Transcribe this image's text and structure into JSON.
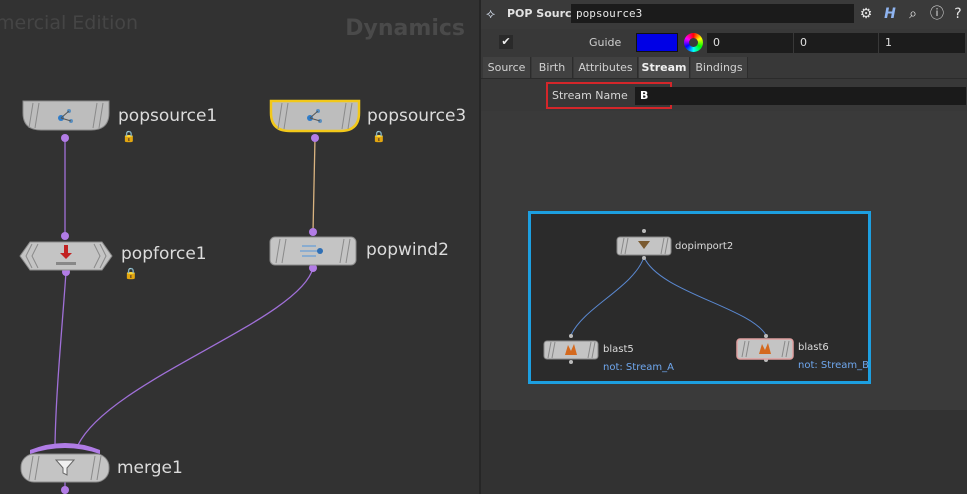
{
  "network": {
    "watermark_left": "mercial Edition",
    "watermark_right": "Dynamics",
    "nodes": {
      "popsource1": "popsource1",
      "popsource3": "popsource3",
      "popforce1": "popforce1",
      "popwind2": "popwind2",
      "merge1": "merge1"
    }
  },
  "params": {
    "node_type": "POP Source",
    "node_name": "popsource3",
    "header_icons": [
      "gear-icon",
      "help-icon",
      "search-icon",
      "info-icon",
      "help-circle-icon"
    ],
    "guide": {
      "label": "Guide",
      "color": "#0000e6",
      "values": [
        "0",
        "0",
        "1"
      ]
    },
    "tabs": [
      "Source",
      "Birth",
      "Attributes",
      "Stream",
      "Bindings"
    ],
    "active_tab": "Stream",
    "stream_name": {
      "label": "Stream Name",
      "value": "B"
    }
  },
  "inset": {
    "nodes": {
      "dopimport2": "dopimport2",
      "blast5": "blast5",
      "blast6": "blast6"
    },
    "blast5_sub": "not: Stream_A",
    "blast6_sub": "not: Stream_B"
  },
  "colors": {
    "highlight_red": "#d4262a",
    "highlight_blue": "#1d9fe0",
    "selected_node": "#f2c81a",
    "wire_purple": "#a070d8"
  }
}
